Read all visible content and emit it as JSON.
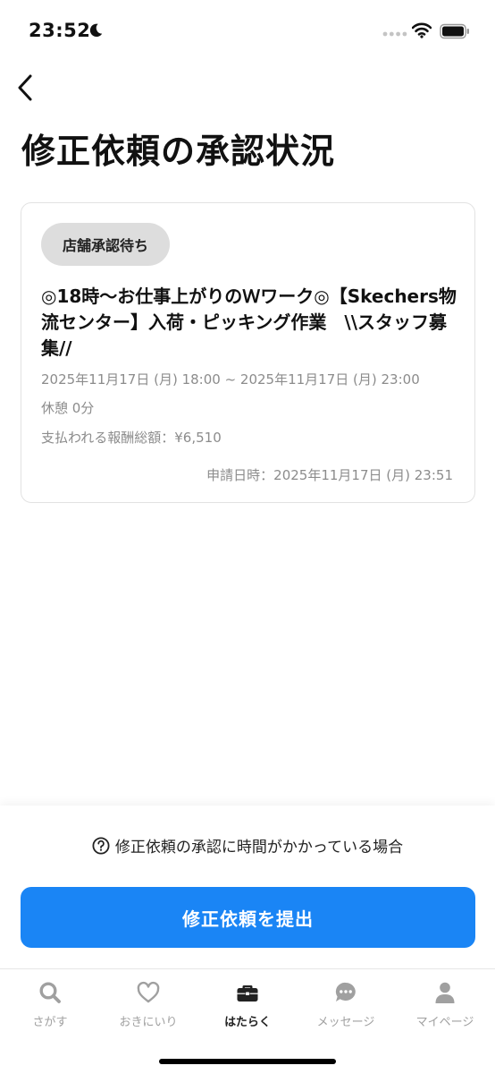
{
  "status_bar": {
    "time": "23:52",
    "icons": [
      "moon-icon",
      "signal-icon",
      "wifi-icon",
      "battery-icon"
    ]
  },
  "header": {
    "back_icon": "chevron-left-icon",
    "title": "修正依頼の承認状況"
  },
  "request": {
    "status": "店舗承認待ち",
    "job_title": "◎18時〜お仕事上がりのＷワーク◎【Skechers物流センター】入荷・ピッキング作業　\\\\スタッフ募集//",
    "datetime": "2025年11月17日 (月) 18:00 ~ 2025年11月17日 (月) 23:00",
    "break": "休憩 0分",
    "pay": "支払われる報酬総額：¥6,510",
    "applied_at": "申請日時：2025年11月17日 (月) 23:51"
  },
  "footer": {
    "help_text": "修正依頼の承認に時間がかかっている場合",
    "help_icon": "question-circle-icon",
    "submit_label": "修正依頼を提出"
  },
  "tabs": [
    {
      "label": "さがす",
      "icon": "search-icon",
      "active": false
    },
    {
      "label": "おきにいり",
      "icon": "heart-icon",
      "active": false
    },
    {
      "label": "はたらく",
      "icon": "briefcase-icon",
      "active": true
    },
    {
      "label": "メッセージ",
      "icon": "chat-icon",
      "active": false
    },
    {
      "label": "マイページ",
      "icon": "person-icon",
      "active": false
    }
  ],
  "colors": {
    "accent": "#1a85f5",
    "badge_bg": "#dddddd",
    "muted_text": "#8c8c8c",
    "inactive_tab": "#a0a0a0"
  }
}
